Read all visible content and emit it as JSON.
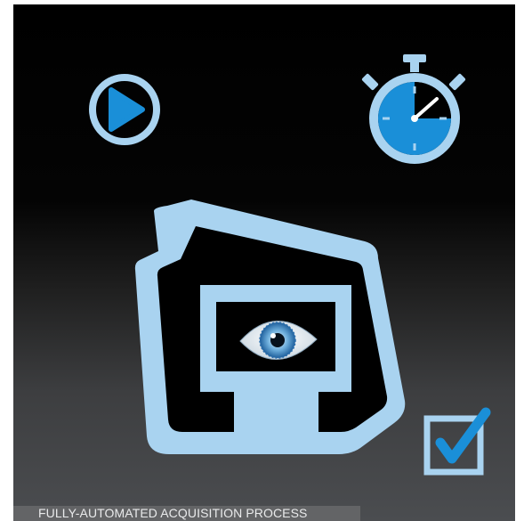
{
  "icons": {
    "play": "play-icon",
    "stopwatch": "stopwatch-icon",
    "device": "scanner-device-icon",
    "eye": "eye-icon",
    "checkbox": "checked-checkbox-icon"
  },
  "colors": {
    "light_blue": "#a9d3f0",
    "accent_blue": "#1a8fd8",
    "caption_bar": "#636466",
    "caption_text": "#e9eaeb"
  },
  "caption": {
    "text": "FULLY-AUTOMATED ACQUISITION PROCESS"
  }
}
